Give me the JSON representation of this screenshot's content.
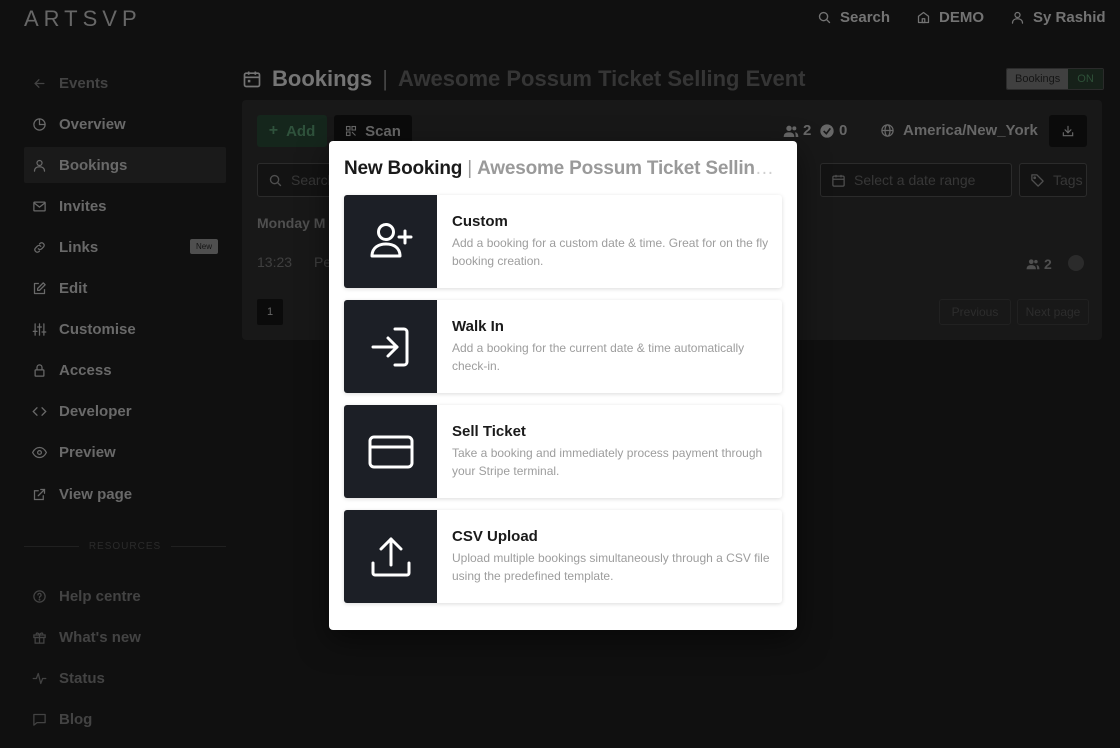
{
  "app": {
    "logo": "ARTSVP"
  },
  "topbar": {
    "search_label": "Search",
    "org_label": "DEMO",
    "user_label": "Sy Rashid"
  },
  "sidebar": {
    "items": [
      {
        "label": "Events",
        "icon": "arrow-left-icon"
      },
      {
        "label": "Overview",
        "icon": "pie-chart-icon"
      },
      {
        "label": "Bookings",
        "icon": "user-icon",
        "active": true
      },
      {
        "label": "Invites",
        "icon": "mail-icon"
      },
      {
        "label": "Links",
        "icon": "link-icon",
        "badge": "New"
      },
      {
        "label": "Edit",
        "icon": "edit-icon"
      },
      {
        "label": "Customise",
        "icon": "sliders-icon"
      },
      {
        "label": "Access",
        "icon": "lock-icon"
      },
      {
        "label": "Developer",
        "icon": "code-icon"
      },
      {
        "label": "Preview",
        "icon": "eye-icon"
      },
      {
        "label": "View page",
        "icon": "external-link-icon"
      }
    ],
    "resources_heading": "RESOURCES",
    "resources": [
      {
        "label": "Help centre",
        "icon": "help-icon"
      },
      {
        "label": "What's new",
        "icon": "gift-icon"
      },
      {
        "label": "Status",
        "icon": "activity-icon"
      },
      {
        "label": "Blog",
        "icon": "message-icon"
      }
    ]
  },
  "header": {
    "title": "Bookings",
    "separator": "|",
    "event_name": "Awesome Possum Ticket Selling Event",
    "toggle_label": "Bookings",
    "toggle_state": "ON"
  },
  "toolbar": {
    "add_label": "Add",
    "scan_label": "Scan",
    "attendee_count": "2",
    "checked_in_count": "0",
    "timezone": "America/New_York"
  },
  "filters": {
    "search_placeholder": "Search",
    "date_placeholder": "Select a date range",
    "tags_label": "Tags"
  },
  "list": {
    "day_label": "Monday M",
    "rows": [
      {
        "time": "13:23",
        "name": "Pe",
        "count": "2"
      }
    ]
  },
  "pagination": {
    "current_page": "1",
    "prev_label": "Previous",
    "next_label": "Next page"
  },
  "modal": {
    "title": "New Booking",
    "separator": "|",
    "event_name": "Awesome Possum Ticket Selling Ev...",
    "options": [
      {
        "title": "Custom",
        "description": "Add a booking for a custom date & time. Great for on the fly booking creation.",
        "icon": "user-plus-icon"
      },
      {
        "title": "Walk In",
        "description": "Add a booking for the current date & time automatically check-in.",
        "icon": "log-in-icon"
      },
      {
        "title": "Sell Ticket",
        "description": "Take a booking and immediately process payment through your Stripe terminal.",
        "icon": "credit-card-icon"
      },
      {
        "title": "CSV Upload",
        "description": "Upload multiple bookings simultaneously through a CSV file using the predefined template.",
        "icon": "upload-icon"
      }
    ]
  },
  "colors": {
    "background": "#161616",
    "modal_bg": "#ffffff",
    "option_icon_bg": "#1c1f26",
    "add_button": "#1c3326"
  }
}
